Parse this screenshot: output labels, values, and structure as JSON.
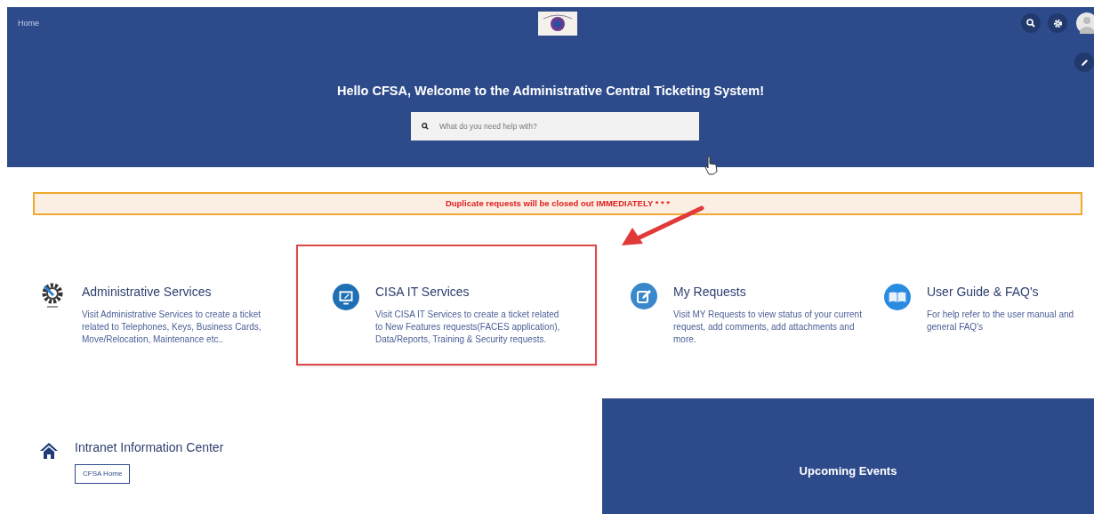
{
  "header": {
    "home_link": "Home",
    "greeting": "Hello CFSA, Welcome to the Administrative Central Ticketing System!",
    "search": {
      "placeholder": "What do you need help with?"
    }
  },
  "banner": "Duplicate requests will be closed out IMMEDIATELY * * *",
  "services": [
    {
      "kind": "gear",
      "title": "Administrative Services",
      "description": "Visit Administrative Services to create a ticket related to Telephones, Keys, Business Cards, Move/Relocation, Maintenance etc..",
      "highlighted": false
    },
    {
      "kind": "monitor",
      "title": "CISA IT Services",
      "description": "Visit CISA IT Services to create a ticket related to New Features requests(FACES application), Data/Reports, Training & Security requests.",
      "highlighted": true
    },
    {
      "kind": "edit",
      "title": "My Requests",
      "description": "Visit MY Requests to view status of your current request, add comments, add attachments and more.",
      "highlighted": false
    },
    {
      "kind": "book",
      "title": "User Guide & FAQ's",
      "description": "For help refer to the user manual and general FAQ's",
      "highlighted": false
    }
  ],
  "intranet": {
    "title": "Intranet Information Center",
    "button": "CFSA Home"
  },
  "events": {
    "title": "Upcoming Events"
  }
}
